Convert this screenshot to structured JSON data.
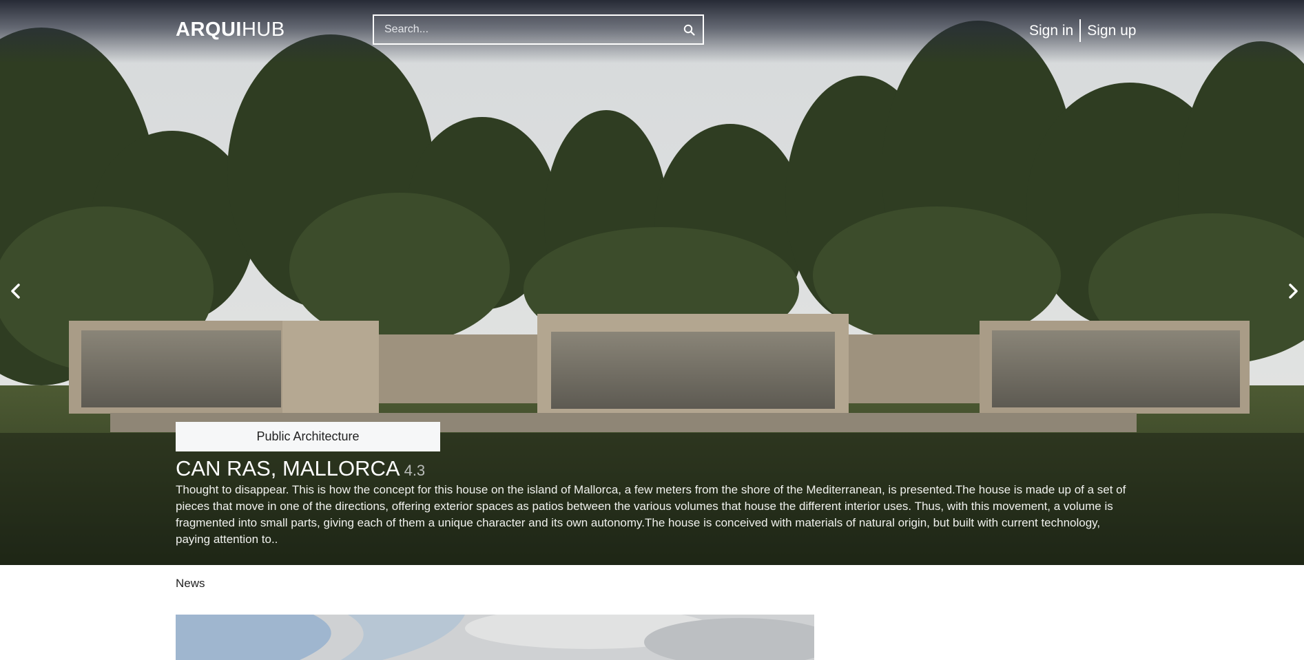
{
  "header": {
    "logo_bold": "ARQUI",
    "logo_light": "HUB",
    "search_placeholder": "Search...",
    "sign_in": "Sign in",
    "sign_up": "Sign up"
  },
  "hero": {
    "category": "Public Architecture",
    "title": "CAN RAS, MALLORCA",
    "rating": "4.3",
    "description": "Thought to disappear. This is how the concept for this house on the island of Mallorca, a few meters from the shore of the Mediterranean, is presented.The house is made up of a set of pieces that move in one of the directions, offering exterior spaces as patios between the various volumes that house the different interior uses. Thus, with this movement, a volume is fragmented into small parts, giving each of them a unique character and its own autonomy.The house is conceived with materials of natural origin, but built with current technology, paying attention to..",
    "prev_icon": "chevron-left-icon",
    "next_icon": "chevron-right-icon"
  },
  "news": {
    "label": "News"
  }
}
